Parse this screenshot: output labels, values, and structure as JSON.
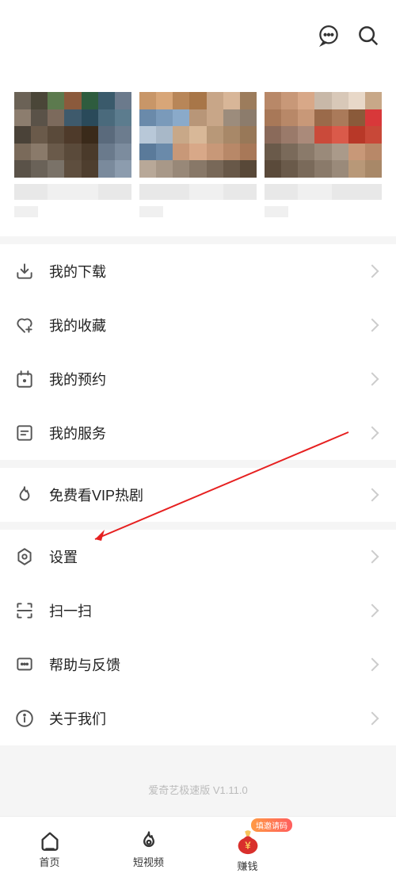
{
  "menu": {
    "group1": [
      {
        "key": "my-downloads",
        "label": "我的下载"
      },
      {
        "key": "my-favorites",
        "label": "我的收藏"
      },
      {
        "key": "my-reservations",
        "label": "我的预约"
      },
      {
        "key": "my-services",
        "label": "我的服务"
      }
    ],
    "group2": [
      {
        "key": "free-vip",
        "label": "免费看VIP热剧"
      }
    ],
    "group3": [
      {
        "key": "settings",
        "label": "设置"
      },
      {
        "key": "scan",
        "label": "扫一扫"
      },
      {
        "key": "help-feedback",
        "label": "帮助与反馈"
      },
      {
        "key": "about-us",
        "label": "关于我们"
      }
    ]
  },
  "footer": {
    "version": "爱奇艺极速版 V1.11.0"
  },
  "nav": {
    "home": "首页",
    "shortvideo": "短视频",
    "earn": "赚钱",
    "badge": "填邀请码"
  }
}
